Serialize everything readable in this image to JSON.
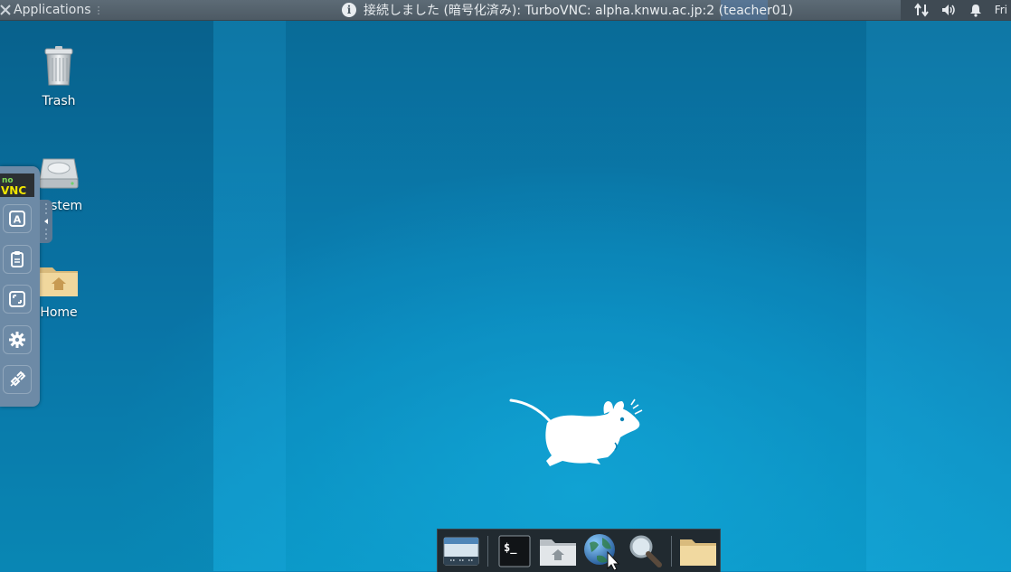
{
  "top_panel": {
    "applications_label": "Applications",
    "window_title": "接続しました (暗号化済み): TurboVNC: alpha.knwu.ac.jp:2 (teacher01)",
    "clock": "Fri"
  },
  "desktop_icons": [
    {
      "label": "Trash",
      "icon": "trash-icon"
    },
    {
      "label": "System",
      "icon": "hard-drive-icon"
    },
    {
      "label": "Home",
      "icon": "home-folder-icon"
    }
  ],
  "vnc_toolbar": {
    "logo_top": "no",
    "logo_bottom": "VNC",
    "buttons": [
      {
        "icon": "keyboard-a-icon"
      },
      {
        "icon": "clipboard-icon"
      },
      {
        "icon": "fullscreen-icon"
      },
      {
        "icon": "gear-icon"
      },
      {
        "icon": "disconnect-icon"
      }
    ]
  },
  "dock": {
    "items": [
      {
        "icon": "show-desktop-icon"
      },
      {
        "icon": "terminal-icon",
        "text": "$_"
      },
      {
        "icon": "home-folder-icon"
      },
      {
        "icon": "web-browser-icon"
      },
      {
        "icon": "search-icon"
      },
      {
        "icon": "folder-icon"
      }
    ]
  },
  "colors": {
    "desktop": "#0a83b6",
    "panel": "#4d5a64",
    "vnc_toolbar": "#6d8aa6",
    "dock": "#212a30"
  }
}
